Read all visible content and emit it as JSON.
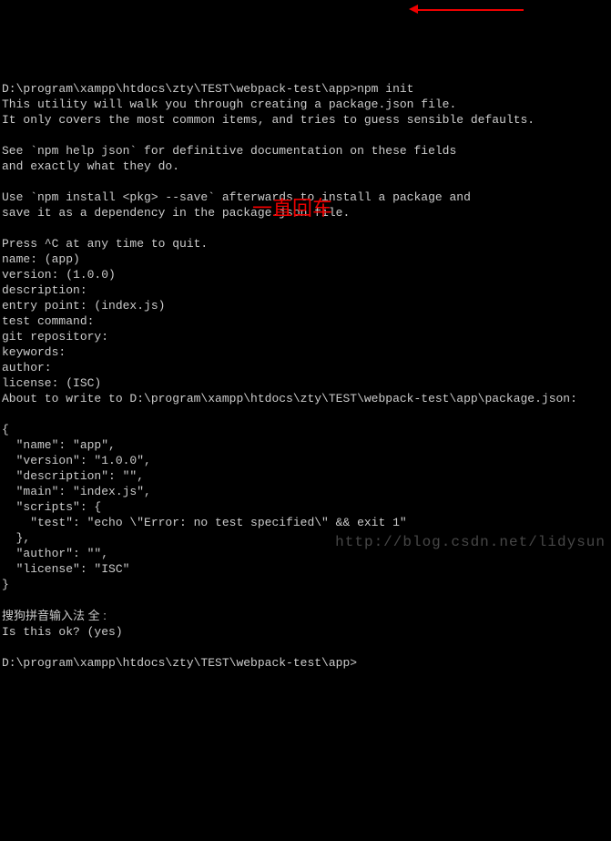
{
  "prompt1": "D:\\program\\xampp\\htdocs\\zty\\TEST\\webpack-test\\app>npm init",
  "intro1": "This utility will walk you through creating a package.json file.",
  "intro2": "It only covers the most common items, and tries to guess sensible defaults.",
  "see1": "See `npm help json` for definitive documentation on these fields",
  "see2": "and exactly what they do.",
  "use1": "Use `npm install <pkg> --save` afterwards to install a package and",
  "use2": "save it as a dependency in the package.json file.",
  "quit": "Press ^C at any time to quit.",
  "fields": {
    "name": "name: (app)",
    "version": "version: (1.0.0)",
    "description": "description:",
    "entry": "entry point: (index.js)",
    "test": "test command:",
    "git": "git repository:",
    "keywords": "keywords:",
    "author": "author:",
    "license": "license: (ISC)"
  },
  "about": "About to write to D:\\program\\xampp\\htdocs\\zty\\TEST\\webpack-test\\app\\package.json:",
  "pkg": {
    "open": "{",
    "name": "  \"name\": \"app\",",
    "version": "  \"version\": \"1.0.0\",",
    "description": "  \"description\": \"\",",
    "main": "  \"main\": \"index.js\",",
    "scriptsOpen": "  \"scripts\": {",
    "test": "    \"test\": \"echo \\\"Error: no test specified\\\" && exit 1\"",
    "scriptsClose": "  },",
    "author": "  \"author\": \"\",",
    "license": "  \"license\": \"ISC\"",
    "close": "}"
  },
  "ime": "搜狗拼音输入法 全 :",
  "confirm": "Is this ok? (yes)",
  "prompt2": "D:\\program\\xampp\\htdocs\\zty\\TEST\\webpack-test\\app>",
  "annotation": "一直回车",
  "watermark": "http://blog.csdn.net/lidysun"
}
